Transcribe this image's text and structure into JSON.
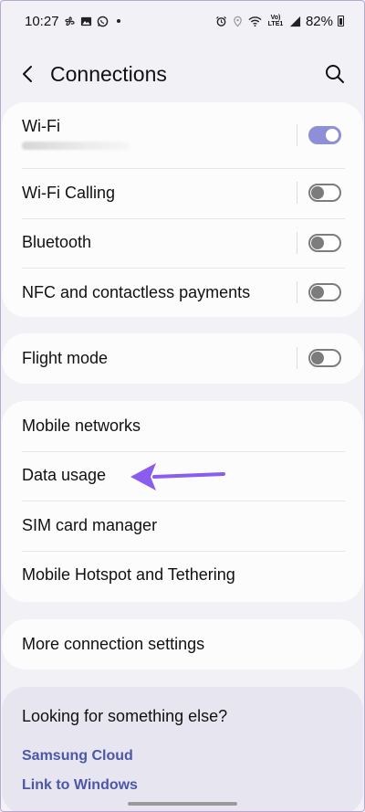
{
  "status": {
    "time": "10:27",
    "signal_label": "Vo) LTE1",
    "battery": "82%"
  },
  "header": {
    "title": "Connections"
  },
  "groups": [
    {
      "items": [
        {
          "label": "Wi-Fi",
          "toggle": true,
          "on": true
        },
        {
          "label": "Wi-Fi Calling",
          "toggle": true,
          "on": false
        },
        {
          "label": "Bluetooth",
          "toggle": true,
          "on": false
        },
        {
          "label": "NFC and contactless payments",
          "toggle": true,
          "on": false
        }
      ]
    },
    {
      "items": [
        {
          "label": "Flight mode",
          "toggle": true,
          "on": false
        }
      ]
    },
    {
      "items": [
        {
          "label": "Mobile networks"
        },
        {
          "label": "Data usage"
        },
        {
          "label": "SIM card manager"
        },
        {
          "label": "Mobile Hotspot and Tethering"
        }
      ]
    },
    {
      "items": [
        {
          "label": "More connection settings"
        }
      ]
    }
  ],
  "looking": {
    "title": "Looking for something else?",
    "links": [
      "Samsung Cloud",
      "Link to Windows"
    ]
  },
  "colors": {
    "accent": "#8e8fd6",
    "link": "#4c57a8",
    "arrow": "#8a5cf0",
    "background": "#f2f1f6"
  },
  "icons": {
    "back": "chevron-left-icon",
    "search": "search-icon",
    "annotation": "arrow-icon"
  }
}
